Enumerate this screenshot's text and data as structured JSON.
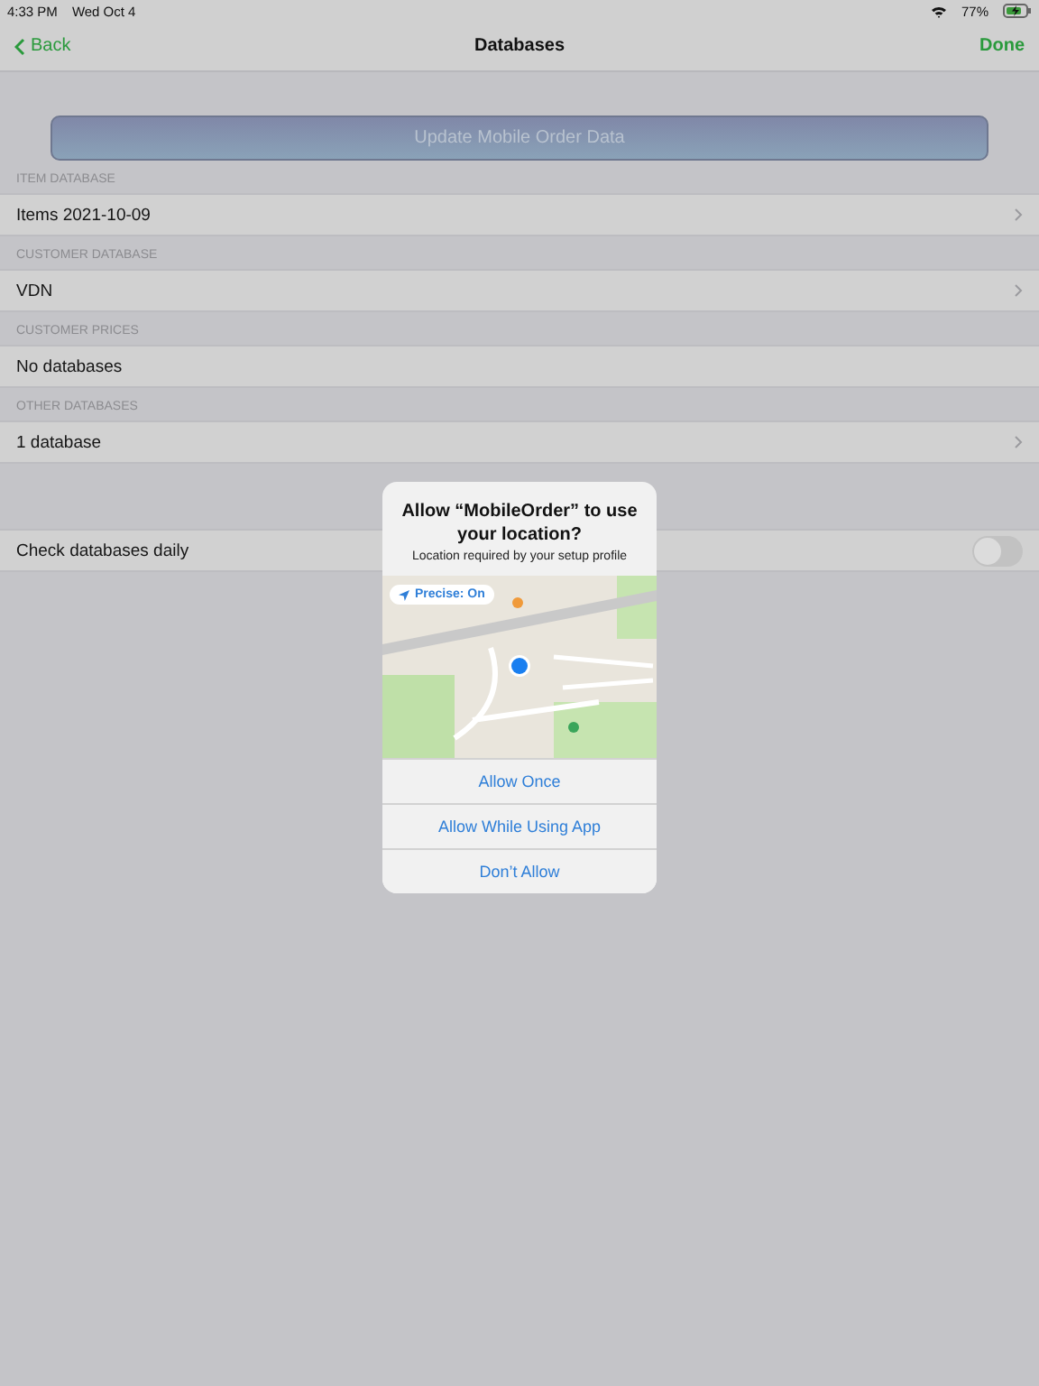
{
  "status_bar": {
    "time": "4:33 PM",
    "date": "Wed Oct 4",
    "battery": "77%"
  },
  "nav": {
    "back": "Back",
    "title": "Databases",
    "done": "Done"
  },
  "update_button": {
    "label": "Update Mobile Order Data",
    "disabled": true
  },
  "sections": [
    {
      "header": "ITEM DATABASE",
      "rows": [
        {
          "label": "Items 2021-10-09",
          "chevron": true
        }
      ]
    },
    {
      "header": "CUSTOMER DATABASE",
      "rows": [
        {
          "label": "VDN",
          "chevron": true
        }
      ]
    },
    {
      "header": "CUSTOMER PRICES",
      "rows": [
        {
          "label": "No databases",
          "chevron": false
        }
      ]
    },
    {
      "header": "OTHER DATABASES",
      "rows": [
        {
          "label": "1 database",
          "chevron": true
        }
      ]
    }
  ],
  "settings": [
    {
      "kind": "toggle",
      "label": "Check databases daily",
      "on": false
    }
  ],
  "alert": {
    "title": "Allow “MobileOrder” to use your location?",
    "message": "Location required by your setup profile",
    "precise_button": "Precise: On",
    "map": {
      "kind": "picture"
    },
    "buttons": [
      "Allow Once",
      "Allow While Using App",
      "Don’t Allow"
    ]
  }
}
